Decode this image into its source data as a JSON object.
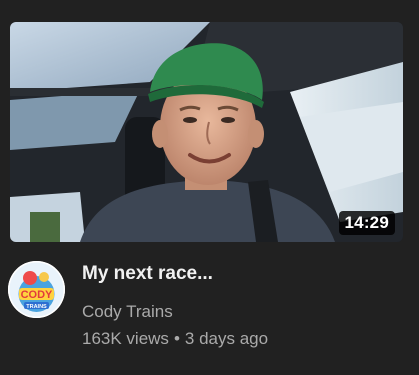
{
  "video": {
    "title": "My next race...",
    "duration": "14:29",
    "channel": "Cody Trains",
    "views": "163K views",
    "separator": "•",
    "age": "3 days ago"
  },
  "avatar": {
    "logo_text": "CODY",
    "logo_subtext": "TRAINS"
  },
  "icons": [
    "video-thumbnail",
    "channel-avatar"
  ]
}
